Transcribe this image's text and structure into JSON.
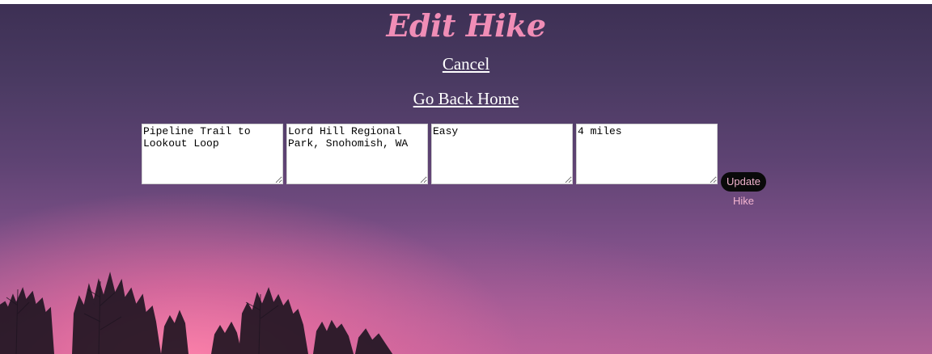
{
  "page": {
    "title": "Edit Hike",
    "title_color": "#f08db6"
  },
  "links": {
    "cancel": "Cancel",
    "home": "Go Back Home"
  },
  "form": {
    "name_value": "Pipeline Trail to Lookout Loop",
    "location_value": "Lord Hill Regional Park, Snohomish, WA",
    "difficulty_value": "Easy",
    "distance_value": "4 miles",
    "submit_label": "Update Hike"
  },
  "background": {
    "description_colors": {
      "sky_top": "#3d3054",
      "sky_bottom_glow": "#ff82aa"
    },
    "silhouette_icon": "tree-silhouette"
  }
}
